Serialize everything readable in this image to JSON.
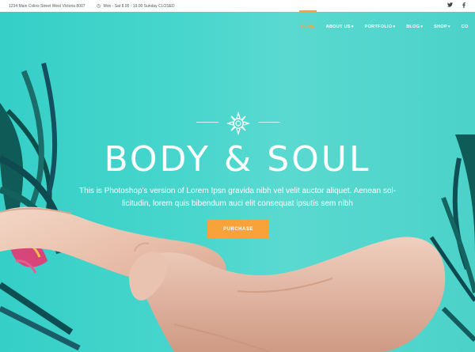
{
  "topbar": {
    "address": "1234 Main Colins Street   West Victoria 8007",
    "hours": "Mon - Sat 8.00 - 19.00   Sunday CLOSED",
    "social_icons": [
      "twitter-icon",
      "facebook-icon"
    ]
  },
  "nav": {
    "items": [
      {
        "label": "HOME",
        "active": true,
        "has_dropdown": false
      },
      {
        "label": "ABOUT US",
        "active": false,
        "has_dropdown": true
      },
      {
        "label": "PORTFOLIO",
        "active": false,
        "has_dropdown": true
      },
      {
        "label": "BLOG",
        "active": false,
        "has_dropdown": true
      },
      {
        "label": "SHOP",
        "active": false,
        "has_dropdown": true
      },
      {
        "label": "CO",
        "active": false,
        "has_dropdown": false
      }
    ],
    "chevron": "▾"
  },
  "hero": {
    "title": "BODY & SOUL",
    "subtitle_line1": "This is Photoshop's version  of Lorem Ipsn gravida nibh vel velit auctor aliquet. Aenean sol-",
    "subtitle_line2": "licitudin, lorem quis bibendum auci elit consequat ipsutis sem nibh",
    "button_label": "PURCHASE",
    "emblem_icon": "lotus-icon"
  },
  "colors": {
    "background": "#48d6cd",
    "accent": "#f7a33a",
    "text": "#ffffff"
  }
}
